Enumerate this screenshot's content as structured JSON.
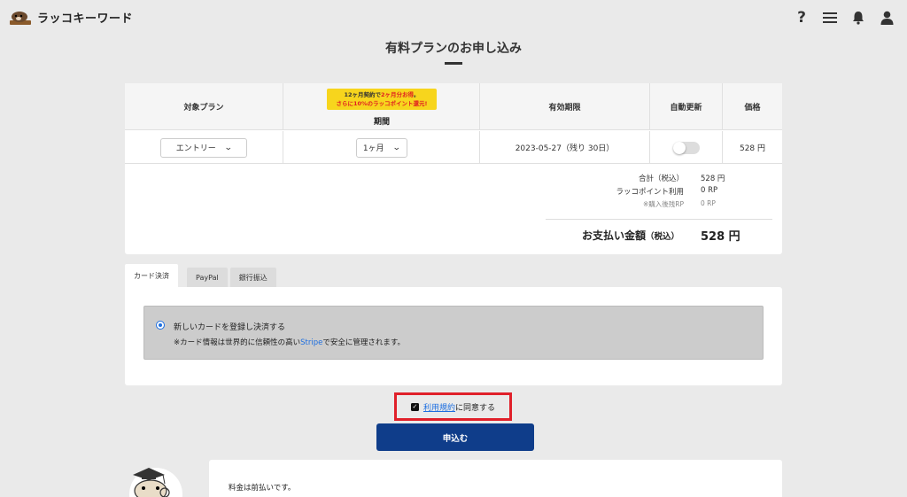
{
  "header": {
    "logo_text": "ラッコキーワード",
    "icons": [
      "help-icon",
      "menu-icon",
      "bell-icon",
      "user-icon"
    ]
  },
  "page": {
    "title": "有料プランのお申し込み"
  },
  "table": {
    "headers": {
      "plan": "対象プラン",
      "period": "期間",
      "expiry": "有効期限",
      "auto_renew": "自動更新",
      "price": "価格"
    },
    "promo": {
      "line1_a": "12ヶ月契約で",
      "line1_b": "2ヶ月分お得",
      "line1_c": "。",
      "line2": "さらに10%のラッコポイント還元!"
    },
    "row": {
      "plan_value": "エントリー",
      "period_value": "1ヶ月",
      "expiry": "2023-05-27（残り 30日）",
      "auto_renew": false,
      "price": "528 円"
    }
  },
  "summary": {
    "total_label": "合計（税込）",
    "total_value": "528 円",
    "points_label": "ラッコポイント利用",
    "points_value": "0 RP",
    "remaining_label": "※購入後残RP",
    "remaining_value": "0 RP",
    "pay_label": "お支払い金額",
    "pay_label_suffix": "（税込）",
    "pay_value": "528 円"
  },
  "tabs": [
    {
      "label": "カード決済",
      "active": true
    },
    {
      "label": "PayPal",
      "active": false
    },
    {
      "label": "銀行振込",
      "active": false
    }
  ],
  "card_option": {
    "title": "新しいカードを登録し決済する",
    "note_a": "※カード情報は世界的に信頼性の高い",
    "note_link": "Stripe",
    "note_b": "で安全に管理されます。"
  },
  "agree": {
    "checked": true,
    "link": "利用規約",
    "text": "に同意する"
  },
  "submit_label": "申込む",
  "info": {
    "text": "料金は前払いです。"
  },
  "colors": {
    "primary_button": "#0f3d8a",
    "link": "#1e6fe0",
    "promo_bg": "#f7d51d",
    "highlight_border": "#e0202a"
  }
}
